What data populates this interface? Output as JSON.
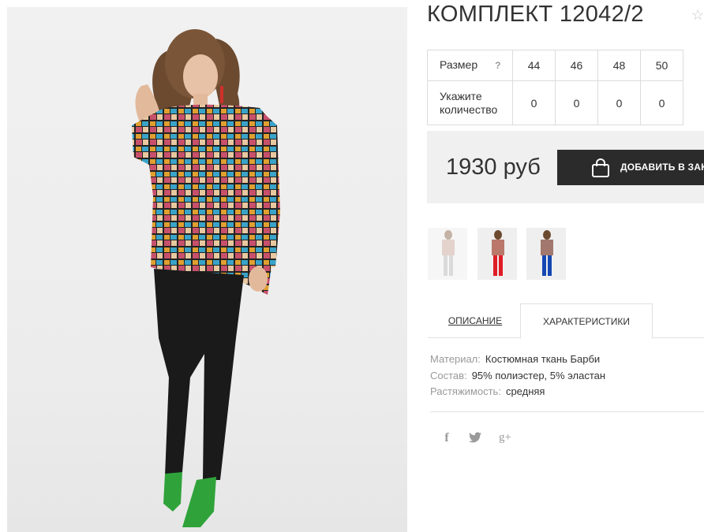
{
  "product": {
    "title": "КОМПЛЕКТ 12042/2",
    "favorite_icon": "star-outline-icon"
  },
  "sizes": {
    "row_label": "Размер",
    "help": "?",
    "values": [
      "44",
      "46",
      "48",
      "50"
    ],
    "qty_label": "Укажите количество",
    "quantities": [
      "0",
      "0",
      "0",
      "0"
    ]
  },
  "price": {
    "text": "1930 руб",
    "cart_button": "ДОБАВИТЬ В ЗАКАЗ",
    "cart_icon": "shopping-bag-icon"
  },
  "thumbnails": [
    {
      "pants_color": "#b7b7b7",
      "top_color": "#c8a89a"
    },
    {
      "pants_color": "#e01c25",
      "top_color": "#b9786a"
    },
    {
      "pants_color": "#1547b3",
      "top_color": "#a2786e"
    }
  ],
  "tabs": {
    "description": "ОПИСАНИЕ",
    "characteristics": "ХАРАКТЕРИСТИКИ",
    "active": "characteristics"
  },
  "characteristics": [
    {
      "key": "Материал:",
      "value": "Костюмная ткань Барби"
    },
    {
      "key": "Состав:",
      "value": "95% полиэстер, 5% эластан"
    },
    {
      "key": "Растяжимость:",
      "value": "средняя"
    }
  ],
  "social": {
    "facebook": "f",
    "google_plus": "g+"
  },
  "colors": {
    "button_bg": "#2b2b2b",
    "price_bg": "#f0f0f0",
    "border": "#dcdcdc",
    "muted": "#999999"
  }
}
